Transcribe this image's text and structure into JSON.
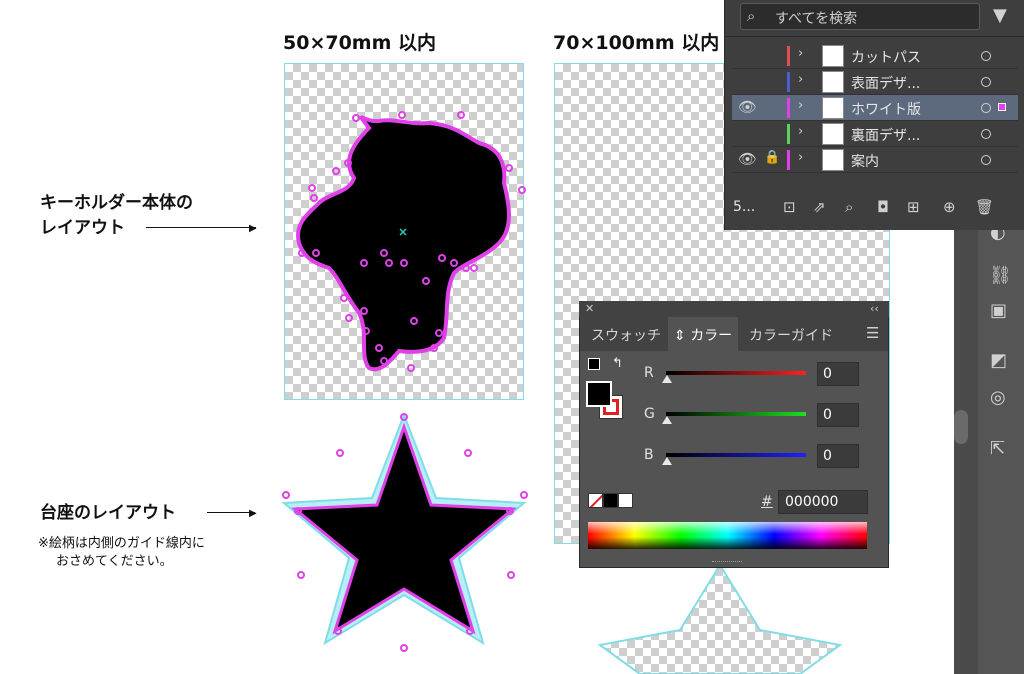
{
  "artboards": {
    "small_title": "50×70mm 以内",
    "large_title": "70×100mm 以内"
  },
  "labels": {
    "keyholder_line1": "キーホルダー本体の",
    "keyholder_line2": "レイアウト",
    "base_title": "台座のレイアウト",
    "base_note_line1": "※絵柄は内側のガイド線内に",
    "base_note_line2": "おさめてください。"
  },
  "layers_panel": {
    "search_placeholder": "すべてを検索",
    "layer_count": "5...",
    "layers": [
      {
        "name": "カットパス",
        "color": "#e05050",
        "visible": false,
        "locked": false,
        "selected": false
      },
      {
        "name": "表面デザ...",
        "color": "#4a5fd8",
        "visible": false,
        "locked": false,
        "selected": false
      },
      {
        "name": "ホワイト版",
        "color": "#e040e8",
        "visible": true,
        "locked": false,
        "selected": true
      },
      {
        "name": "裏面デザ...",
        "color": "#5ed060",
        "visible": false,
        "locked": false,
        "selected": false
      },
      {
        "name": "案内",
        "color": "#e040e8",
        "visible": true,
        "locked": true,
        "selected": false
      }
    ]
  },
  "color_panel": {
    "tabs": [
      "スウォッチ",
      "カラー",
      "カラーガイド"
    ],
    "active_tab": "カラー",
    "channels": [
      {
        "label": "R",
        "value": "0",
        "color": "#ff2020"
      },
      {
        "label": "G",
        "value": "0",
        "color": "#20e020"
      },
      {
        "label": "B",
        "value": "0",
        "color": "#2020ff"
      }
    ],
    "hex_label": "#",
    "hex_value": "000000"
  },
  "colors": {
    "anchor_magenta": "#e040e8",
    "guide_cyan": "#7fdde8"
  }
}
